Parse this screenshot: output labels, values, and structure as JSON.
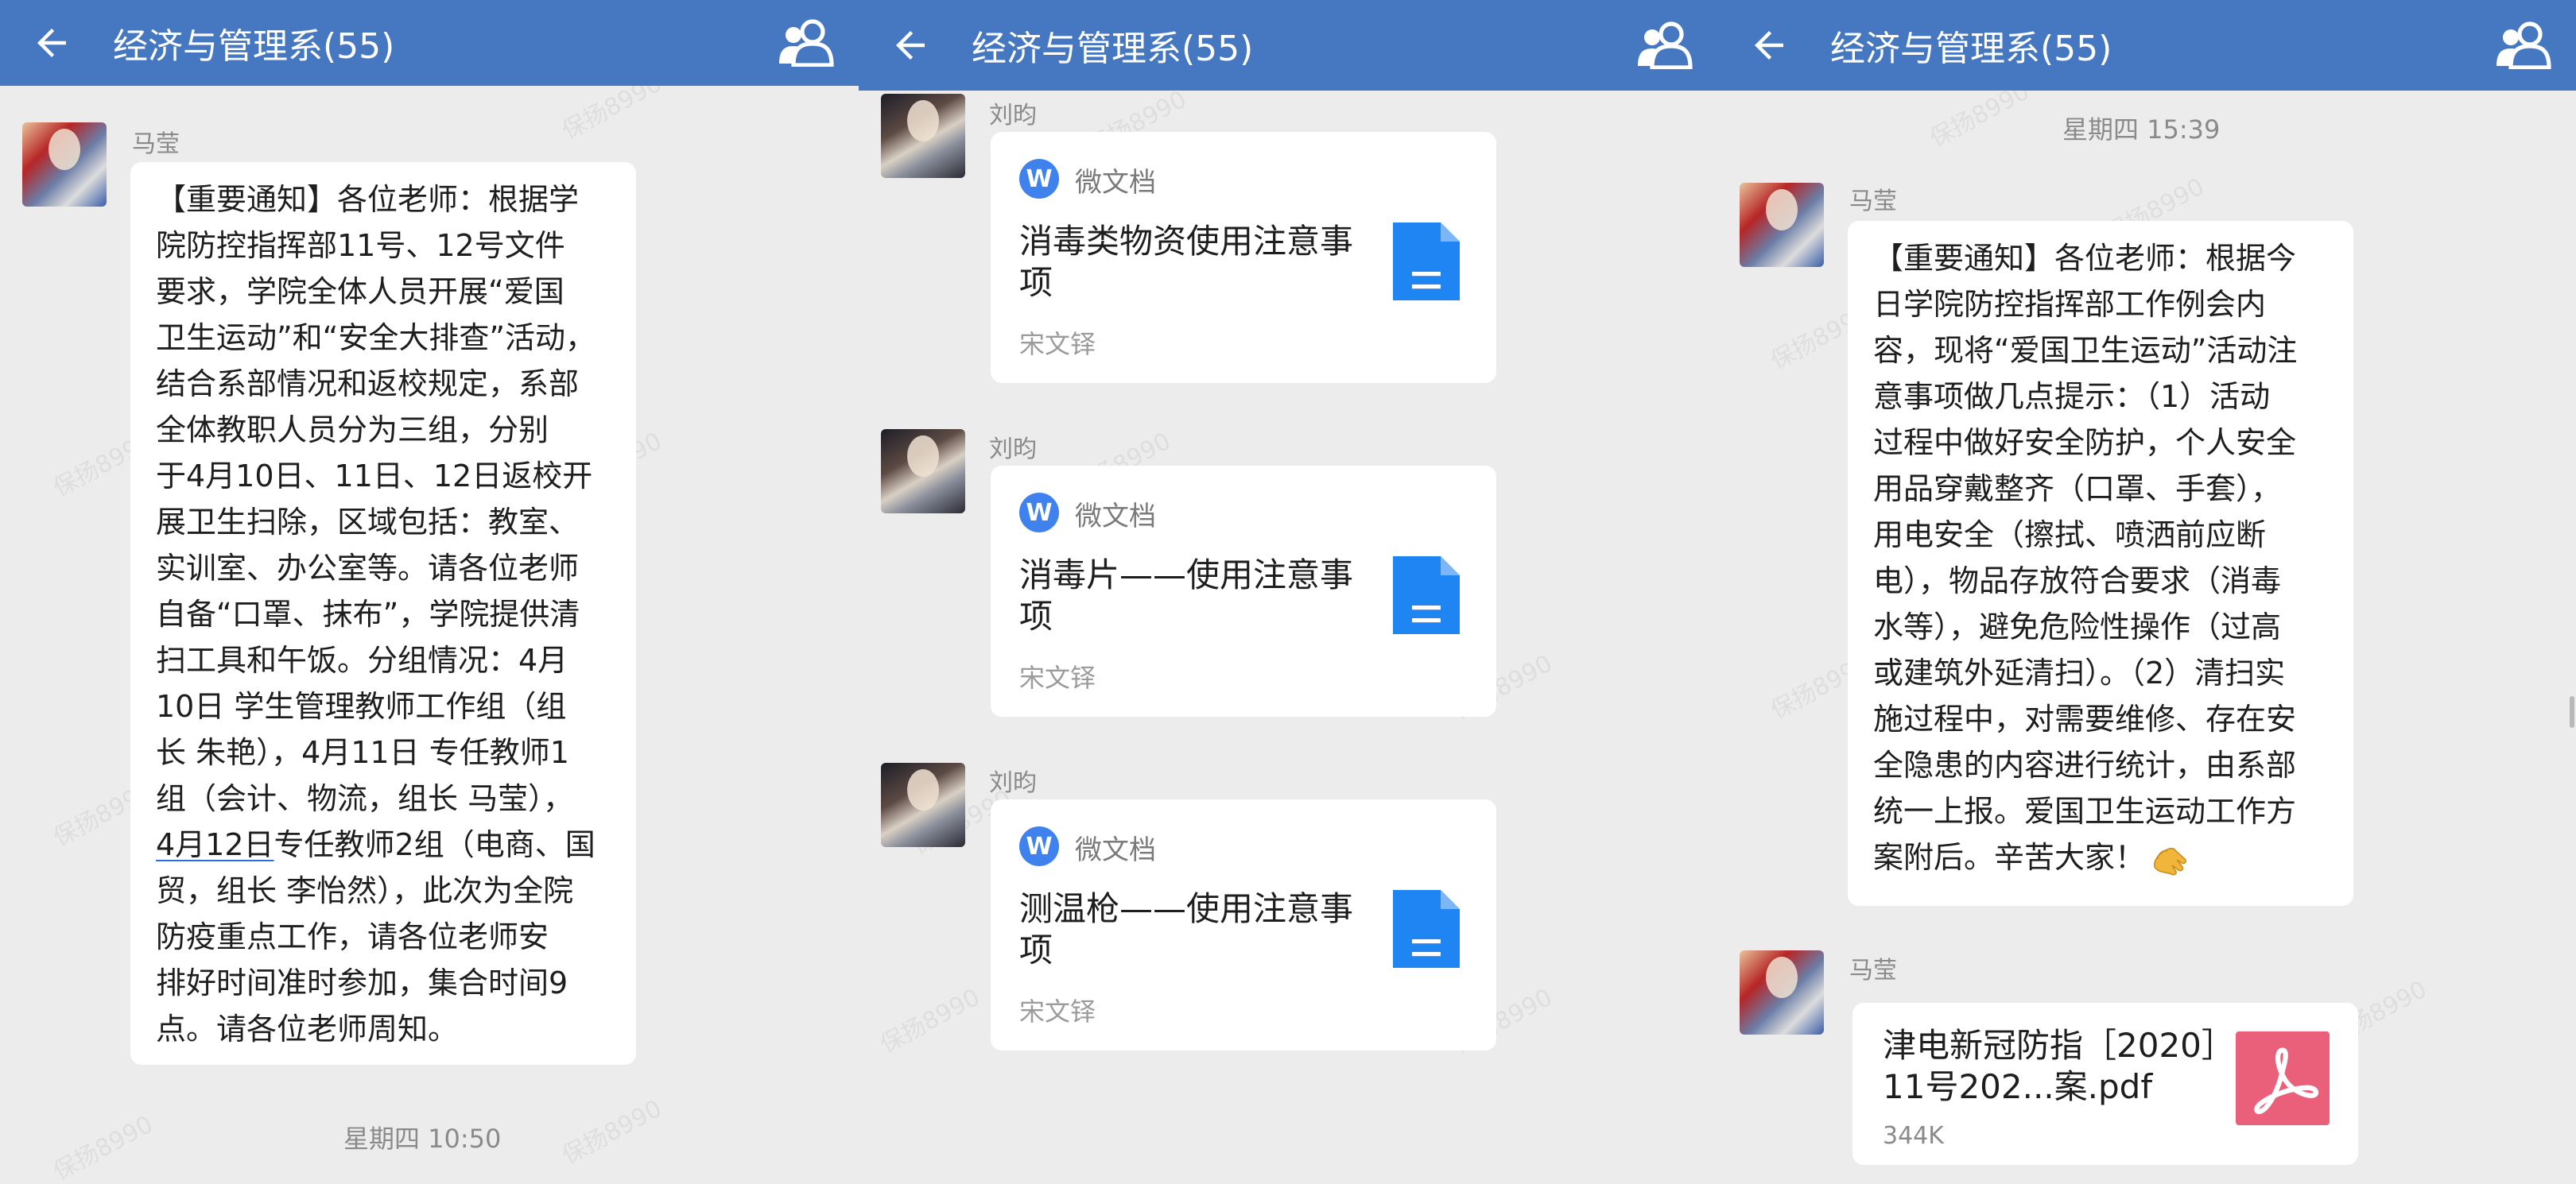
{
  "header": {
    "title": "经济与管理系(55)"
  },
  "watermark": "保扬8990",
  "panel1": {
    "sender": "马莹",
    "message": "【重要通知】各位老师：根据学\n院防控指挥部11号、12号文件\n要求，学院全体人员开展“爱国\n卫生运动”和“安全大排查”活动，\n结合系部情况和返校规定，系部\n全体教职人员分为三组，分别\n于4月10日、11日、12日返校开\n展卫生扫除，区域包括：教室、\n实训室、办公室等。请各位老师\n自备“口罩、抹布”，学院提供清\n扫工具和午饭。分组情况：4月\n10日 学生管理教师工作组（组\n长 朱艳），4月11日 专任教师1\n组（会计、物流，组长 马莹），\n",
    "message_link": "4月12日",
    "message_tail": "专任教师2组（电商、国\n贸，组长 李怡然），此次为全院\n防疫重点工作，请各位老师安\n排好时间准时参加，集合时间9\n点。请各位老师周知。",
    "timestamp": "星期四 10:50"
  },
  "panel2": {
    "messages": [
      {
        "sender": "刘昀",
        "app": "微文档",
        "doc_title": "消毒类物资使用注意事项",
        "source": "宋文铎"
      },
      {
        "sender": "刘昀",
        "app": "微文档",
        "doc_title": "消毒片——使用注意事项",
        "source": "宋文铎"
      },
      {
        "sender": "刘昀",
        "app": "微文档",
        "doc_title": "测温枪——使用注意事项",
        "source": "宋文铎"
      }
    ]
  },
  "panel3": {
    "timestamp": "星期四 15:39",
    "sender": "马莹",
    "message": "【重要通知】各位老师：根据今\n日学院防控指挥部工作例会内\n容，现将“爱国卫生运动”活动注\n意事项做几点提示：（1）活动\n过程中做好安全防护，个人安全\n用品穿戴整齐（口罩、手套），\n用电安全（擦拭、喷洒前应断\n电），物品存放符合要求（消毒\n水等），避免危险性操作（过高\n或建筑外延清扫）。（2）清扫实\n施过程中，对需要维修、存在安\n全隐患的内容进行统计，由系部\n统一上报。爱国卫生运动工作方\n案附后。辛苦大家！",
    "file_sender": "马莹",
    "file_name": "津电新冠防指［2020］11号202...案.pdf",
    "file_size": "344K"
  },
  "colors": {
    "header": "#4678c1",
    "bubble": "#ffffff",
    "background": "#ececec",
    "doc_icon": "#1f85f2",
    "pdf_icon": "#ea5f79"
  },
  "icons": [
    "back-arrow-icon",
    "group-members-icon",
    "wedoc-logo-icon",
    "document-icon",
    "pdf-icon",
    "clap-hands-emoji"
  ]
}
